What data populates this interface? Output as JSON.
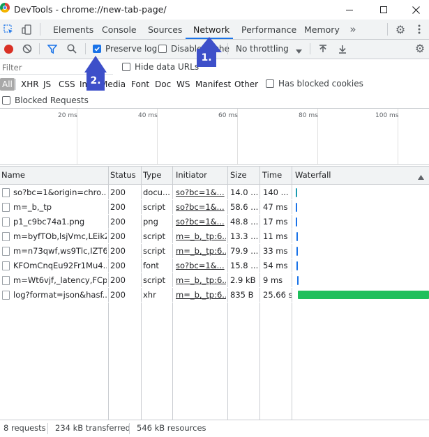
{
  "window": {
    "title": "DevTools - chrome://new-tab-page/"
  },
  "tabs": [
    {
      "label": "Elements"
    },
    {
      "label": "Console"
    },
    {
      "label": "Sources"
    },
    {
      "label": "Network",
      "active": true
    },
    {
      "label": "Performance"
    },
    {
      "label": "Memory"
    }
  ],
  "toolbar": {
    "preserve_log_label": "Preserve log",
    "preserve_log_checked": true,
    "disable_cache_label": "Disable cache",
    "throttling": "No throttling"
  },
  "filterbar": {
    "placeholder": "Filter",
    "hide_data_urls_label": "Hide data URLs",
    "types": [
      "All",
      "XHR",
      "JS",
      "CSS",
      "Img",
      "Media",
      "Font",
      "Doc",
      "WS",
      "Manifest",
      "Other"
    ],
    "has_blocked_cookies_label": "Has blocked cookies",
    "blocked_requests_label": "Blocked Requests"
  },
  "overview": {
    "ticks": [
      "20 ms",
      "40 ms",
      "60 ms",
      "80 ms",
      "100 ms"
    ]
  },
  "table": {
    "columns": [
      "Name",
      "Status",
      "Type",
      "Initiator",
      "Size",
      "Time",
      "Waterfall"
    ],
    "rows": [
      {
        "name": "so?bc=1&origin=chro...",
        "status": "200",
        "type": "docu...",
        "initiator": "so?bc=1&...",
        "size": "14.0 ...",
        "time": "140 ...",
        "wf_color": "#1a9bb0"
      },
      {
        "name": "m=_b,_tp",
        "status": "200",
        "type": "script",
        "initiator": "so?bc=1&...",
        "size": "58.6 ...",
        "time": "47 ms",
        "wf_color": "#1a73e8"
      },
      {
        "name": "p1_c9bc74a1.png",
        "status": "200",
        "type": "png",
        "initiator": "so?bc=1&...",
        "size": "48.8 ...",
        "time": "17 ms",
        "wf_color": "#1a73e8"
      },
      {
        "name": "m=byfTOb,lsjVmc,LEikZe",
        "status": "200",
        "type": "script",
        "initiator": "m=_b,_tp:6...",
        "size": "13.3 ...",
        "time": "11 ms",
        "wf_color": "#1a73e8"
      },
      {
        "name": "m=n73qwf,ws9Tlc,IZT6...",
        "status": "200",
        "type": "script",
        "initiator": "m=_b,_tp:6...",
        "size": "79.9 ...",
        "time": "33 ms",
        "wf_color": "#1a73e8"
      },
      {
        "name": "KFOmCnqEu92Fr1Mu4...",
        "status": "200",
        "type": "font",
        "initiator": "so?bc=1&...",
        "size": "15.8 ...",
        "time": "54 ms",
        "wf_color": "#1a73e8"
      },
      {
        "name": "m=Wt6vjf,_latency,FCp...",
        "status": "200",
        "type": "script",
        "initiator": "m=_b,_tp:6...",
        "size": "2.9 kB",
        "time": "9 ms",
        "wf_color": "#1a73e8"
      },
      {
        "name": "log?format=json&hasf...",
        "status": "200",
        "type": "xhr",
        "initiator": "m=_b,_tp:6...",
        "size": "835 B",
        "time": "25.66 s",
        "wf_color": "#1fbf5c"
      }
    ]
  },
  "statusbar": {
    "requests": "8 requests",
    "transferred": "234 kB transferred",
    "resources": "546 kB resources"
  },
  "annotations": [
    {
      "label": "1."
    },
    {
      "label": "2."
    }
  ],
  "colors": {
    "accent": "#1a73e8",
    "record": "#d93025",
    "annotation": "#3d4fc9",
    "waterfall_long": "#1fbf5c"
  }
}
